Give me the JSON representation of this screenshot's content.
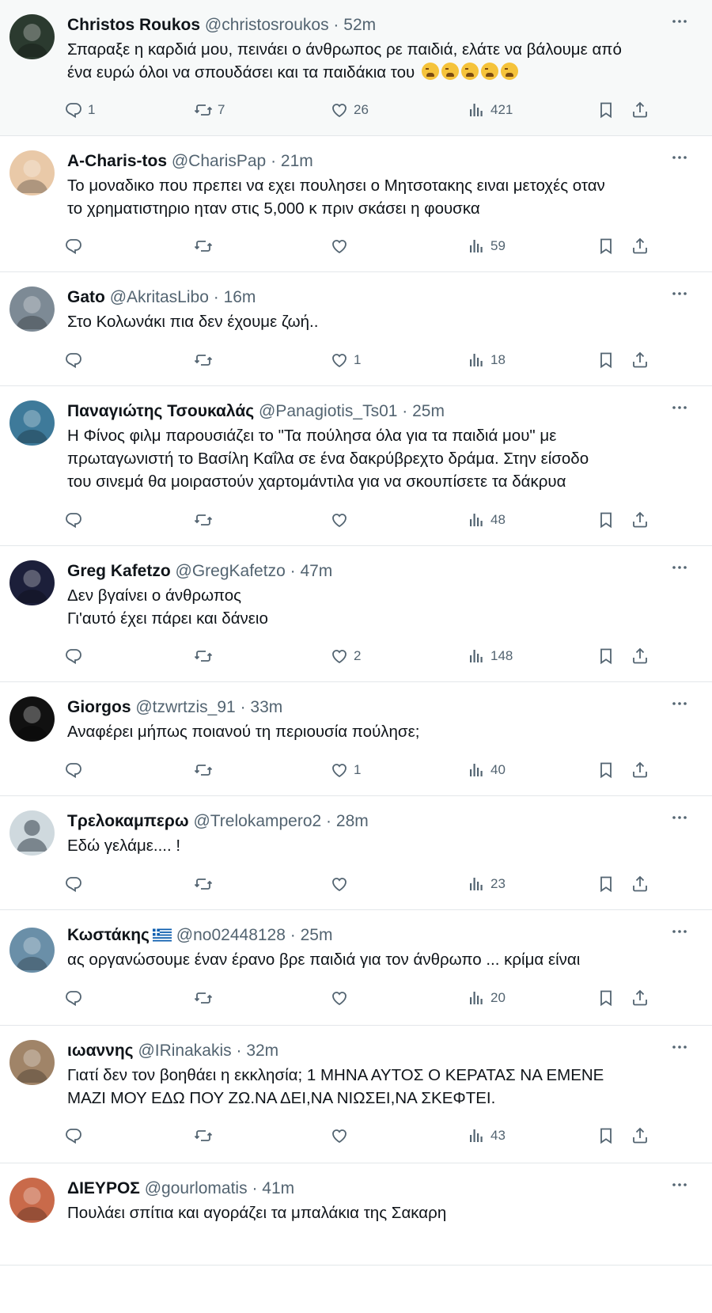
{
  "tweets": [
    {
      "name": "Christos Roukos",
      "handle": "@christosroukos",
      "dot": "·",
      "time": "52m",
      "lines": [
        "Σπαραξε η καρδιά μου, πεινάει ο άνθρωπος ρε παιδιά, ελάτε να βάλουμε από",
        "ένα ευρώ όλοι να σπουδάσει και τα παιδάκια του"
      ],
      "emoji_count": 5,
      "replies": "1",
      "retweets": "7",
      "likes": "26",
      "views": "421",
      "avatar_color": "#2b3a2f"
    },
    {
      "name": "A-Charis-tos",
      "handle": "@CharisPap",
      "dot": "·",
      "time": "21m",
      "lines": [
        "Το μοναδικο που πρεπει να εχει πουλησει ο Μητσοτακης ειναι μετοχές οταν",
        "το χρηματιστηριο ηταν στις 5,000 κ πριν σκάσει η φουσκα"
      ],
      "replies": "",
      "retweets": "",
      "likes": "",
      "views": "59",
      "avatar_color": "#e9c9a8"
    },
    {
      "name": "Gato",
      "handle": "@AkritasLibo",
      "dot": "·",
      "time": "16m",
      "lines": [
        "Στο Κολωνάκι πια δεν έχουμε ζωή.."
      ],
      "replies": "",
      "retweets": "",
      "likes": "1",
      "views": "18",
      "avatar_color": "#7d8a95"
    },
    {
      "name": "Παναγιώτης Τσουκαλάς",
      "handle": "@Panagiotis_Ts01",
      "dot": "·",
      "time": "25m",
      "lines": [
        "Η Φίνος φιλμ παρουσιάζει το \"Τα πούλησα όλα για τα παιδιά μου\" με",
        "πρωταγωνιστή το Βασίλη Καΐλα σε ένα δακρύβρεχτο δράμα. Στην είσοδο",
        "του σινεμά θα μοιραστούν χαρτομάντιλα για να σκουπίσετε τα δάκρυα"
      ],
      "replies": "",
      "retweets": "",
      "likes": "",
      "views": "48",
      "avatar_color": "#3e7a9a"
    },
    {
      "name": "Greg Kafetzo",
      "handle": "@GregKafetzo",
      "dot": "·",
      "time": "47m",
      "lines": [
        "Δεν βγαίνει ο άνθρωπος",
        "Γι'αυτό έχει πάρει και δάνειο"
      ],
      "replies": "",
      "retweets": "",
      "likes": "2",
      "views": "148",
      "avatar_color": "#1c1f3a"
    },
    {
      "name": "Giorgos",
      "handle": "@tzwrtzis_91",
      "dot": "·",
      "time": "33m",
      "lines": [
        "Αναφέρει μήπως  ποιανού τη περιουσία πούλησε;"
      ],
      "replies": "",
      "retweets": "",
      "likes": "1",
      "views": "40",
      "avatar_color": "#111111"
    },
    {
      "name": "Τρελοκαμπερω",
      "handle": "@Trelokampero2",
      "dot": "·",
      "time": "28m",
      "lines": [
        "Εδώ γελάμε.... !"
      ],
      "replies": "",
      "retweets": "",
      "likes": "",
      "views": "23",
      "avatar_color": "#cfd9de"
    },
    {
      "name": "Κωστάκης",
      "handle": "@no02448128",
      "dot": "·",
      "time": "25m",
      "flag": "greek-flag",
      "lines": [
        "ας οργανώσουμε έναν έρανο βρε παιδιά για τον άνθρωπο ... κρίμα είναι"
      ],
      "replies": "",
      "retweets": "",
      "likes": "",
      "views": "20",
      "avatar_color": "#6a8fa8"
    },
    {
      "name": "ιωαννης",
      "handle": "@IRinakakis",
      "dot": "·",
      "time": "32m",
      "lines": [
        "Γιατί δεν τον βοηθάει η εκκλησία; 1 ΜΗΝΑ ΑΥΤΟΣ Ο ΚΕΡΑΤΑΣ ΝΑ ΕΜΕΝΕ",
        "ΜΑΖΙ ΜΟΥ ΕΔΩ ΠΟΥ ΖΩ.ΝΑ ΔΕΙ,ΝΑ ΝΙΩΣΕΙ,ΝΑ ΣΚΕΦΤΕΙ."
      ],
      "replies": "",
      "retweets": "",
      "likes": "",
      "views": "43",
      "avatar_color": "#a08468"
    },
    {
      "name": "ΔΙΕΥΡΟΣ",
      "handle": "@gourlomatis",
      "dot": "·",
      "time": "41m",
      "lines": [
        "Πουλάει σπίτια και αγοράζει τα μπαλάκια της Σακαρη"
      ],
      "replies": "",
      "retweets": "",
      "likes": "",
      "views": "",
      "avatar_color": "#c96a4a"
    }
  ]
}
